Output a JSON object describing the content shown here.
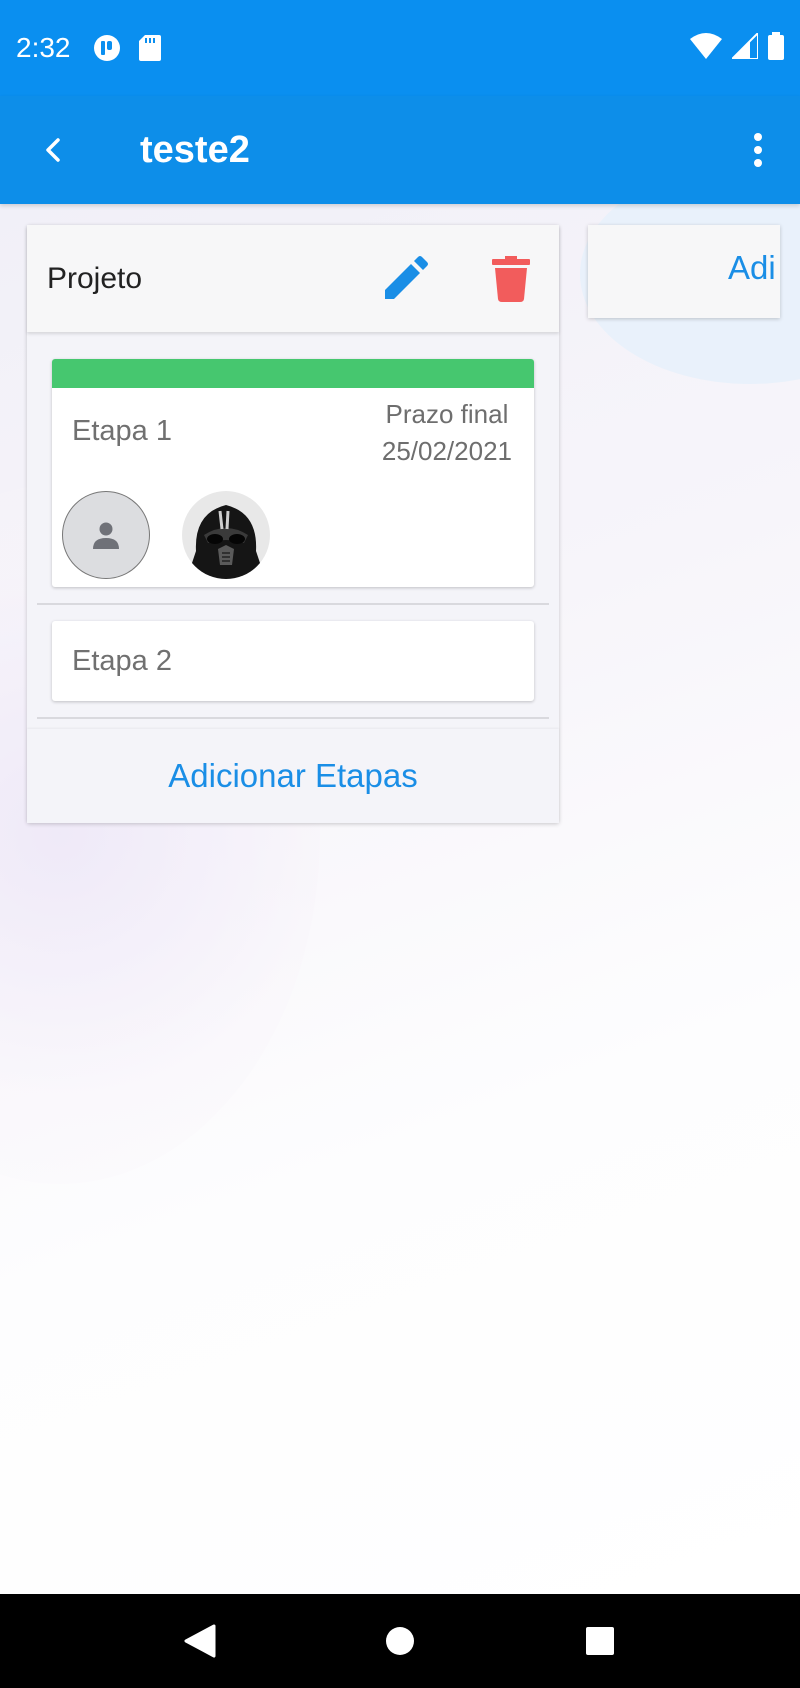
{
  "status_bar": {
    "time": "2:32",
    "icons_left": [
      "app-notification-icon",
      "sd-card-icon"
    ],
    "icons_right": [
      "wifi-icon",
      "signal-icon",
      "battery-icon"
    ]
  },
  "app_bar": {
    "title": "teste2",
    "back_icon": "chevron-left-icon",
    "menu_icon": "more-vert-icon"
  },
  "column": {
    "title": "Projeto",
    "edit_icon": "pencil-icon",
    "delete_icon": "trash-icon",
    "stages": [
      {
        "name": "Etapa 1",
        "color": "#46c76f",
        "deadline_label": "Prazo final",
        "deadline_date": "25/02/2021",
        "members": [
          "default-avatar",
          "photo-avatar"
        ]
      },
      {
        "name": "Etapa 2"
      }
    ],
    "add_button": "Adicionar Etapas"
  },
  "column2": {
    "label": "Adi"
  },
  "nav_bar": {
    "icons": [
      "back-triangle-icon",
      "home-circle-icon",
      "recents-square-icon"
    ]
  },
  "colors": {
    "primary": "#0d8ee9",
    "accent_text": "#1a8ee6",
    "delete": "#f25c5c",
    "stage_bar": "#46c76f"
  }
}
